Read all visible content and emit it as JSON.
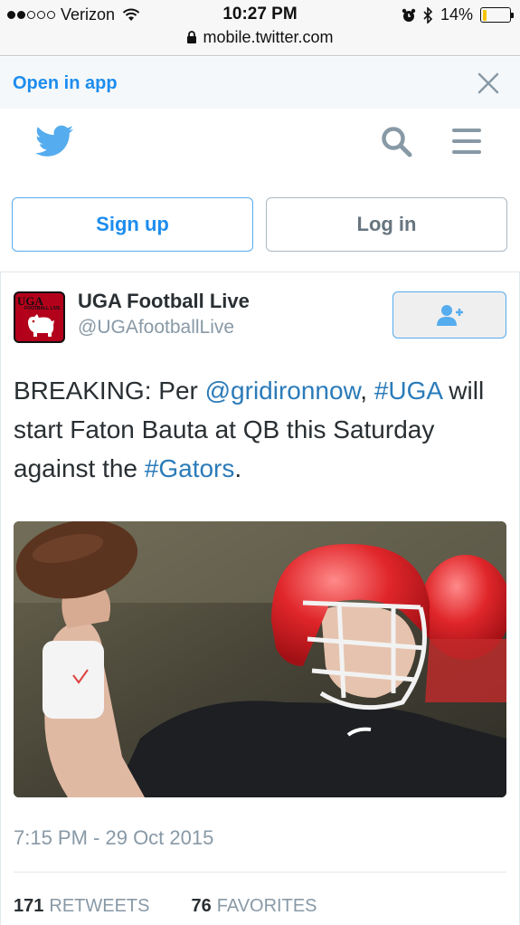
{
  "status_bar": {
    "carrier": "Verizon",
    "time": "10:27 PM",
    "battery": "14%",
    "battery_level": 0.14,
    "signal_bars_filled": 2,
    "signal_bars_total": 5,
    "url": "mobile.twitter.com"
  },
  "open_bar": {
    "link_label": "Open in app"
  },
  "auth": {
    "signup_label": "Sign up",
    "login_label": "Log in"
  },
  "tweet": {
    "name": "UGA Football Live",
    "handle": "@UGAfootballLive",
    "avatar_text": "UGA",
    "avatar_subtext": "FOOTBALL LIVE",
    "text": {
      "t1": "BREAKING: Per ",
      "mention": "@gridironnow",
      "t2": ", ",
      "hashtag1": "#UGA",
      "t3": " will start Faton Bauta at QB this Saturday against the ",
      "hashtag2": "#Gators",
      "t4": "."
    },
    "timestamp": "7:15 PM - 29 Oct 2015",
    "retweets_count": "171",
    "retweets_label": "RETWEETS",
    "favorites_count": "76",
    "favorites_label": "FAVORITES"
  },
  "icons": {
    "lock": "lock-icon",
    "close": "close-icon",
    "logo": "twitter-bird-icon",
    "search": "search-icon",
    "menu": "menu-icon",
    "follow": "follow-user-icon"
  },
  "colors": {
    "twitter_blue": "#55acee",
    "link_blue": "#1d8dee",
    "text_dark": "#292f33",
    "text_gray": "#8899a6",
    "uga_red": "#b3001b"
  }
}
